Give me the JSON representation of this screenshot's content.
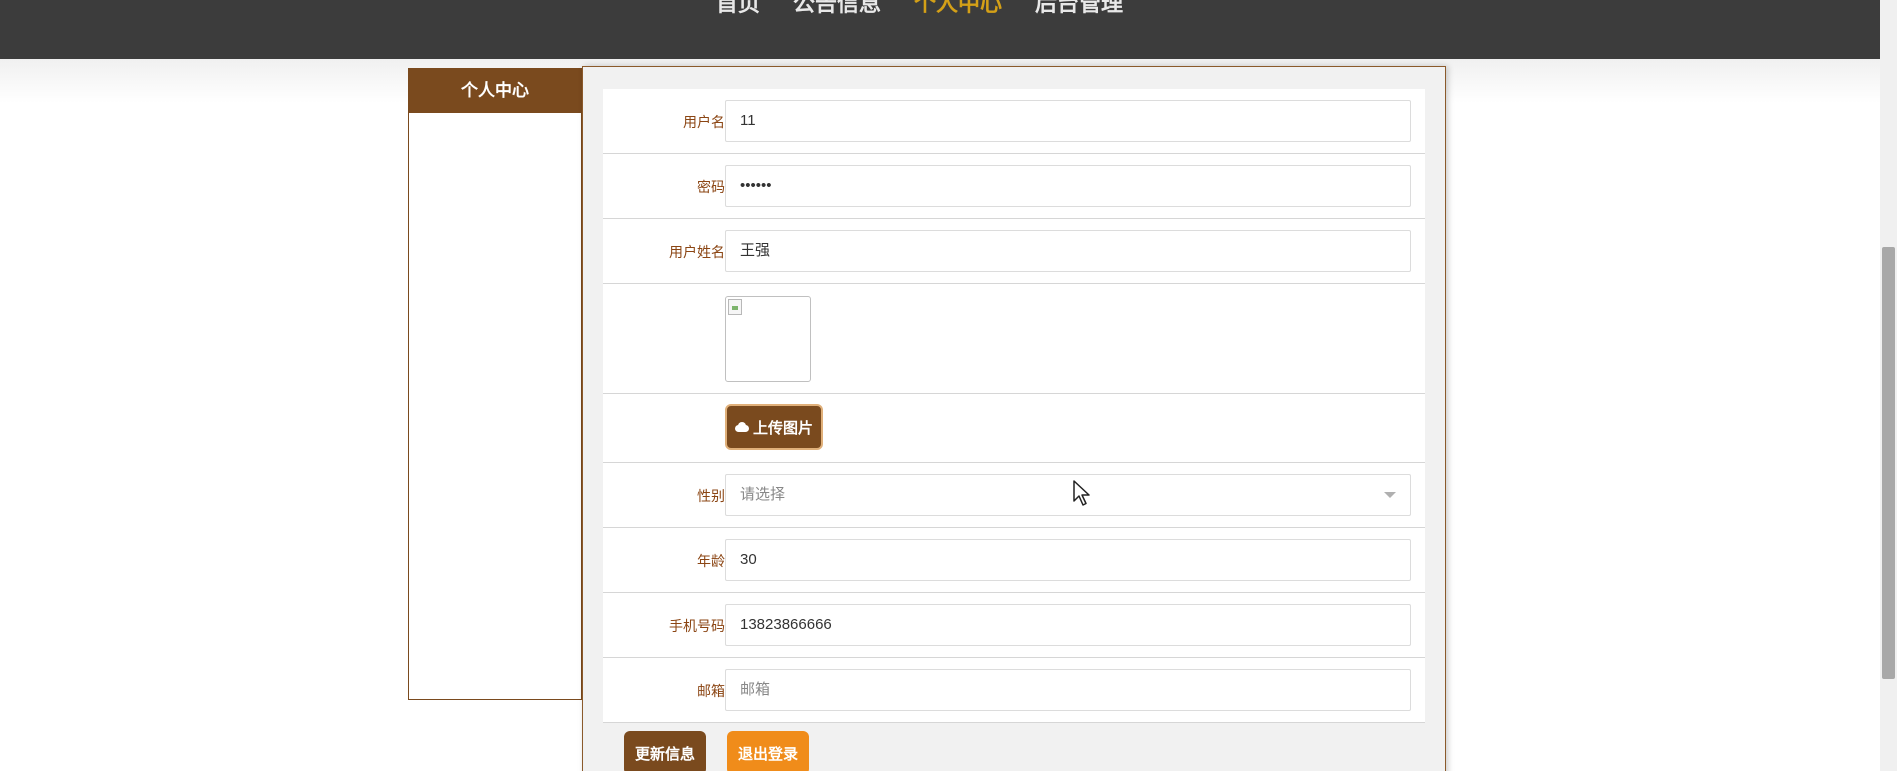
{
  "nav": {
    "items": [
      {
        "label": "首页"
      },
      {
        "label": "公告信息"
      },
      {
        "label": "个人中心"
      },
      {
        "label": "后台管理"
      }
    ],
    "active_index": 2
  },
  "sidebar": {
    "header": "个人中心"
  },
  "form": {
    "username": {
      "label": "用户名",
      "value": "11"
    },
    "password": {
      "label": "密码",
      "value": "••••••"
    },
    "realname": {
      "label": "用户姓名",
      "value": "王强"
    },
    "upload": {
      "label": "上传图片"
    },
    "gender": {
      "label": "性别",
      "placeholder": "请选择"
    },
    "age": {
      "label": "年龄",
      "value": "30"
    },
    "phone": {
      "label": "手机号码",
      "value": "13823866666"
    },
    "email": {
      "label": "邮箱",
      "placeholder": "邮箱"
    }
  },
  "actions": {
    "update": "更新信息",
    "logout": "退出登录"
  },
  "colors": {
    "nav_bg": "#3c3c3c",
    "nav_active": "#d4a017",
    "brand_brown": "#7a4a1e",
    "logout_orange": "#f08c1a"
  }
}
